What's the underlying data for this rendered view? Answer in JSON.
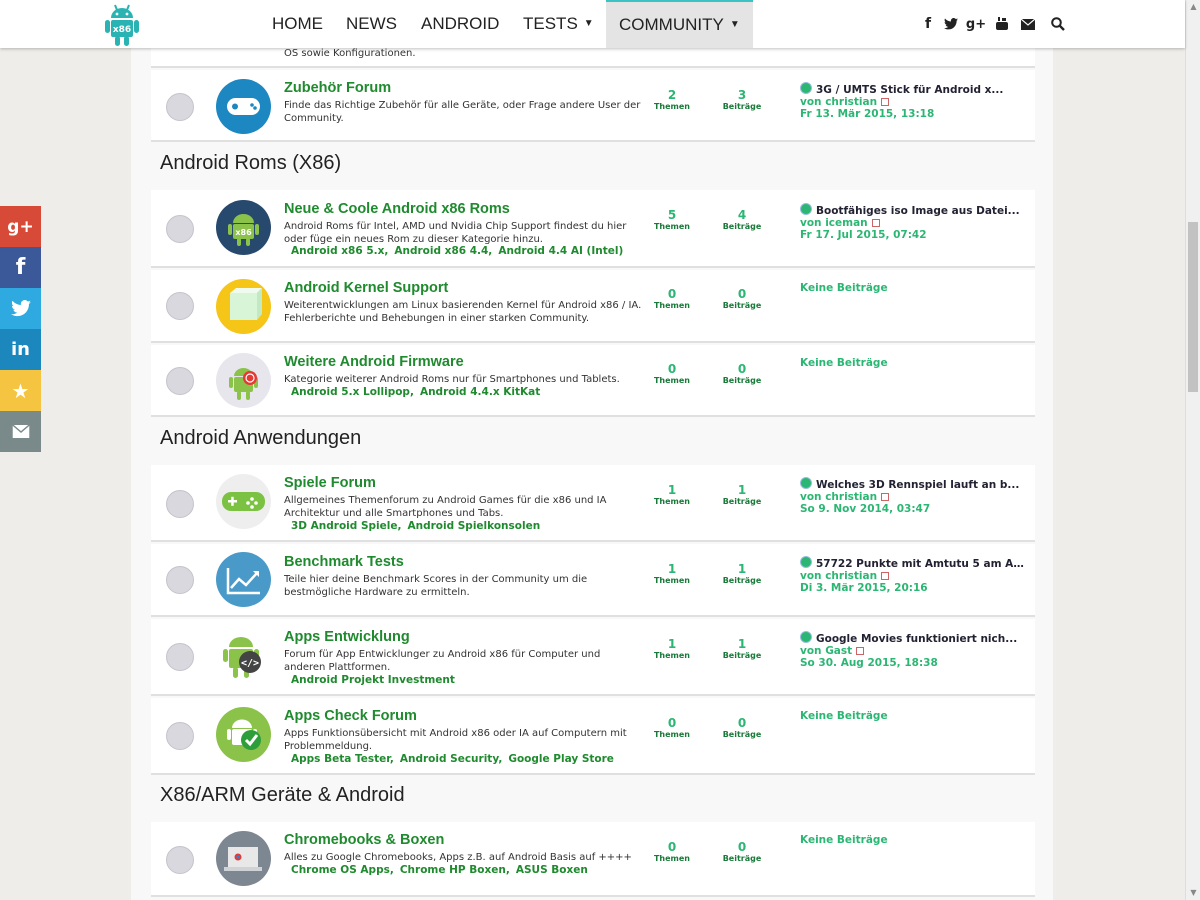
{
  "nav": {
    "home": "HOME",
    "news": "NEWS",
    "android": "ANDROID",
    "tests": "TESTS",
    "community": "COMMUNITY",
    "logo_text": "x86"
  },
  "social_top": [
    "f",
    "t",
    "g+",
    "yt",
    "mail",
    "search"
  ],
  "partial_top_desc": "OS sowie Konfigurationen.",
  "sections": {
    "roms": "Android Roms (X86)",
    "apps": "Android Anwendungen",
    "devices": "X86/ARM Geräte & Android"
  },
  "labels": {
    "themen": "Themen",
    "beitraege": "Beiträge",
    "keine": "Keine Beiträge"
  },
  "forums": {
    "zubehoer": {
      "title": "Zubehör Forum",
      "desc": "Finde das Richtige Zubehör für alle Geräte, oder Frage andere User der Community.",
      "themen": "2",
      "beitraege": "3",
      "post": "3G / UMTS Stick für Android x...",
      "by": "von christian",
      "date": "Fr 13. Mär 2015, 13:18"
    },
    "roms": {
      "title": "Neue & Coole Android x86 Roms",
      "desc": "Android Roms für Intel, AMD und Nvidia Chip Support findest du hier oder füge ein neues Rom zu dieser Kategorie hinzu.",
      "subs": [
        "Android x86 5.x,",
        "Android x86 4.4,",
        "Android 4.4 AI (Intel)"
      ],
      "themen": "5",
      "beitraege": "4",
      "post": "Bootfähiges iso Image aus Datei...",
      "by": "von iceman",
      "date": "Fr 17. Jul 2015, 07:42"
    },
    "kernel": {
      "title": "Android Kernel Support",
      "desc": "Weiterentwicklungen am Linux basierenden Kernel für Android x86 / IA. Fehlerberichte und Behebungen in einer starken Community.",
      "themen": "0",
      "beitraege": "0"
    },
    "firmware": {
      "title": "Weitere Android Firmware",
      "desc": "Kategorie weiterer Android Roms nur für Smartphones und Tablets.",
      "subs": [
        "Android 5.x Lollipop,",
        "Android 4.4.x KitKat"
      ],
      "themen": "0",
      "beitraege": "0"
    },
    "spiele": {
      "title": "Spiele Forum",
      "desc": "Allgemeines Themenforum zu Android Games für die x86 und IA Architektur und alle Smartphones und Tabs.",
      "subs": [
        "3D Android Spiele,",
        "Android Spielkonsolen"
      ],
      "themen": "1",
      "beitraege": "1",
      "post": "Welches 3D Rennspiel lauft an b...",
      "by": "von christian",
      "date": "So 9. Nov 2014, 03:47"
    },
    "benchmark": {
      "title": "Benchmark Tests",
      "desc": "Teile hier deine Benchmark Scores in der Community um die bestmögliche Hardware zu ermitteln.",
      "themen": "1",
      "beitraege": "1",
      "post": "57722 Punkte mit Amtutu 5 am As...",
      "by": "von christian",
      "date": "Di 3. Mär 2015, 20:16"
    },
    "apps": {
      "title": "Apps Entwicklung",
      "desc": "Forum für App Entwicklunger zu Android x86 für Computer und anderen Plattformen.",
      "subs": [
        "Android Projekt Investment"
      ],
      "themen": "1",
      "beitraege": "1",
      "post": "Google Movies funktioniert nich...",
      "by": "von Gast",
      "date": "So 30. Aug 2015, 18:38"
    },
    "check": {
      "title": "Apps Check Forum",
      "desc": "Apps Funktionsübersicht mit Android x86 oder IA auf Computern mit Problemmeldung.",
      "subs": [
        "Apps Beta Tester,",
        "Android Security,",
        "Google Play Store"
      ],
      "themen": "0",
      "beitraege": "0"
    },
    "chrome": {
      "title": "Chromebooks & Boxen",
      "desc": "Alles zu Google Chromebooks, Apps z.B. auf Android Basis auf ++++",
      "subs": [
        "Chrome OS Apps,",
        "Chrome HP Boxen,",
        "ASUS Boxen"
      ],
      "themen": "0",
      "beitraege": "0"
    }
  },
  "share": [
    "g+",
    "f",
    "t",
    "in",
    "★",
    "✉"
  ]
}
